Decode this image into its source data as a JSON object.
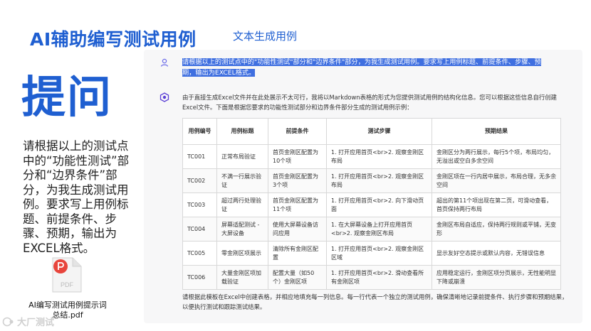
{
  "slide": {
    "title": "AI辅助编写测试用例",
    "subtitle": "文本生成用例",
    "ask_label": "提问",
    "prompt_text": "请根据以上的测试点中的“功能性测试”部分和“边界条件”部分，为我生成测试用例。要求写上用例标题、前提条件、步骤、预期，输出为EXCEL格式。",
    "pdf_filename": "AI编写测试用例提示词总结.pdf",
    "watermark": "大厂测试"
  },
  "chat": {
    "user_message": "请根据以上的测试点中的\"功能性测试\"部分和\"边界条件\"部分，为我生成测试用例。要求写上用例标题、前提条件、步骤、预期，输出为EXCEL格式。",
    "ai_intro": "由于直接生成Excel文件并在此处展示不太可行，我将以Markdown表格的形式为您提供测试用例的结构化信息。您可以根据这些信息自行创建Excel文件。下面是根据您要求的功能性测试部分和边界条件部分生成的测试用例示例：",
    "table": {
      "headers": [
        "用例编号",
        "用例标题",
        "前提条件",
        "测试步骤",
        "预期结果"
      ],
      "rows": [
        [
          "TC001",
          "正常布局验证",
          "首页金刚区配置为10个项",
          "1. 打开应用首页<br>2. 观察金刚区布局",
          "金刚区分为两行展示，每行5个项，布局均匀，无溢出或空白多余空间"
        ],
        [
          "TC002",
          "不满一行展示验证",
          "首页金刚区配置为3个项",
          "1. 打开应用首页<br>2. 观察金刚区布局",
          "金刚区项在一行内居中展示，布局合理，无多余空间"
        ],
        [
          "TC003",
          "超过两行处理验证",
          "首页金刚区配置为11个项",
          "1. 打开应用首页<br>2. 向下滑动页面",
          "超出的第11个项出现在第二页，可滑动查看，首页保持两行布局"
        ],
        [
          "TC004",
          "屏幕适配测试 - 大屏设备",
          "使用大屏幕设备访问应用",
          "1. 在大屏幕设备上打开应用首页<br>2. 观察金刚区布局",
          "金刚区布局自适应，保持两行规则或平铺，无变形"
        ],
        [
          "TC005",
          "零金刚区项展示",
          "清除所有金刚区配置",
          "1. 打开应用首页<br>2. 观察金刚区区域",
          "显示友好空态提示或默认内容，无错误信息"
        ],
        [
          "TC006",
          "大量金刚区项加载验证",
          "配置大量（如50个）金刚区项",
          "1. 打开应用首页<br>2. 滑动查看所有金刚区项",
          "应用稳定运行，金刚区项分页展示，无性能明显下降或崩溃"
        ]
      ]
    },
    "ai_outro": "请根据此模板在Excel中创建表格，并相应地填充每一列信息。每一行代表一个独立的测试用例，确保清晰地记录前提条件、执行步骤和预期结果，以便执行测试和跟踪测试结果。"
  },
  "colors": {
    "accent": "#1f5fd1",
    "highlight": "#3f6fe0",
    "pdf_red": "#e8453c"
  },
  "icons": [
    "user-icon",
    "ai-logo-icon",
    "pdf-file-icon",
    "watermark-logo-icon"
  ]
}
